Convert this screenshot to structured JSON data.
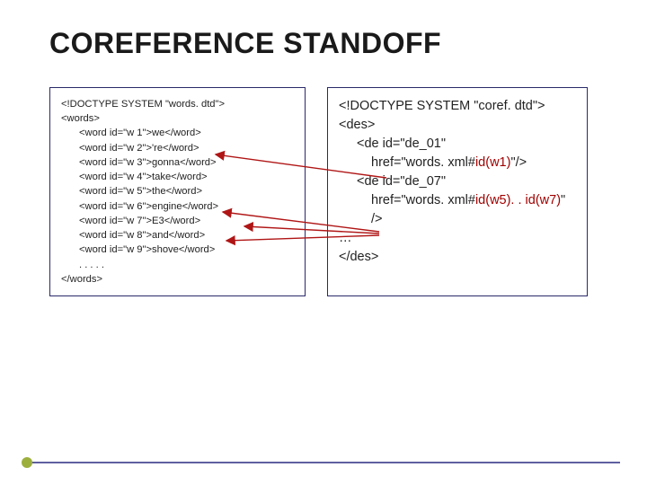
{
  "title": "COREFERENCE STANDOFF",
  "left": {
    "l1": "<!DOCTYPE SYSTEM \"words. dtd\">",
    "l2": "<words>",
    "w1": "<word id=\"w 1\">we</word>",
    "w2": "<word id=\"w 2\">'re</word>",
    "w3": "<word id=\"w 3\">gonna</word>",
    "w4": "<word id=\"w 4\">take</word>",
    "w5": "<word id=\"w 5\">the</word>",
    "w6": "<word id=\"w 6\">engine</word>",
    "w7": "<word id=\"w 7\">E3</word>",
    "w8": "<word id=\"w 8\">and</word>",
    "w9": "<word id=\"w 9\">shove</word>",
    "dots": ". . . . .",
    "close": "</words>"
  },
  "right": {
    "l1": "<!DOCTYPE SYSTEM \"coref. dtd\">",
    "l2": "<des>",
    "l3a": "<de id=\"de_01\"",
    "l3b": "href=\"words. xml#",
    "l3c": "id(w1)",
    "l3d": "\"/>",
    "l4a": "<de id=\"de_07\"",
    "l4b": "href=\"words. xml#",
    "l4c": "id(w5). . id(w7)",
    "l4d": "\"",
    "l4e": "/>",
    "ell": "…",
    "close": "</des>"
  }
}
